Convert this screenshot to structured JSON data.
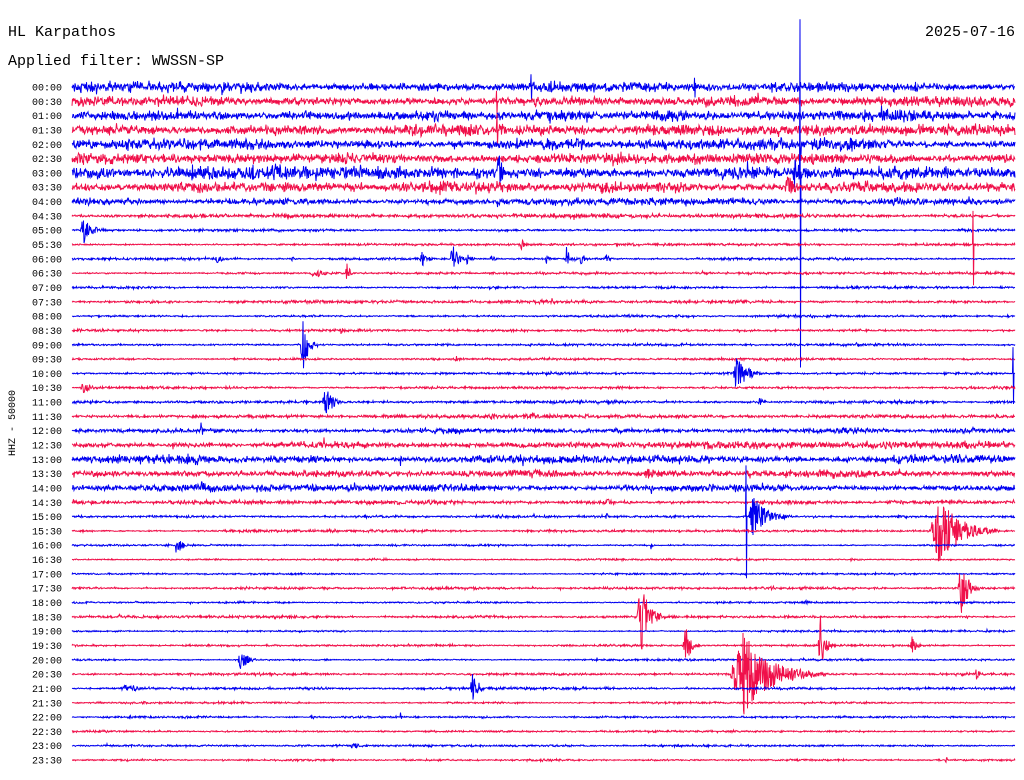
{
  "chart_data": {
    "type": "line",
    "title": "HL Karpathos",
    "date": "2025-07-16",
    "filter": "Applied filter: WWSSN-SP",
    "ylabel": "HHZ - 50000",
    "trace_colors": [
      "#0000f0",
      "#f0104a"
    ],
    "rows": [
      {
        "label": "00:00",
        "noise": 0.42,
        "events": [
          {
            "t": 14.6,
            "amp": 0.8,
            "dur": 0.05
          },
          {
            "t": 19.8,
            "amp": 0.7,
            "dur": 0.05
          }
        ]
      },
      {
        "label": "00:30",
        "noise": 0.42,
        "events": [
          {
            "t": 13.5,
            "amp": 0.7,
            "dur": 0.05
          }
        ]
      },
      {
        "label": "01:00",
        "noise": 0.45,
        "events": []
      },
      {
        "label": "01:30",
        "noise": 0.49,
        "events": [
          {
            "t": 13.52,
            "amp": 0.8,
            "dur": 0.05
          }
        ]
      },
      {
        "label": "02:00",
        "noise": 0.49,
        "events": [
          {
            "t": 23.16,
            "amp": 1.0,
            "dur": 0.1
          }
        ]
      },
      {
        "label": "02:30",
        "noise": 0.42,
        "events": []
      },
      {
        "label": "03:00",
        "noise": 0.49,
        "events": [
          {
            "t": 6.3,
            "amp": 0.7,
            "dur": 0.6
          },
          {
            "t": 13.52,
            "amp": 2.3,
            "dur": 0.35
          },
          {
            "t": 22.9,
            "amp": 1.1,
            "dur": 0.6
          },
          {
            "t": 23.16,
            "amp": 11,
            "dur": 0.05
          }
        ]
      },
      {
        "label": "03:30",
        "noise": 0.42,
        "events": [
          {
            "t": 22.68,
            "amp": 1.1,
            "dur": 0.7
          }
        ]
      },
      {
        "label": "04:00",
        "noise": 0.28,
        "events": [
          {
            "t": 13.52,
            "amp": 0.9,
            "dur": 0.1
          }
        ]
      },
      {
        "label": "04:30",
        "noise": 0.17,
        "events": []
      },
      {
        "label": "05:00",
        "noise": 0.1,
        "events": [
          {
            "t": 0.25,
            "amp": 1.0,
            "dur": 0.9
          }
        ]
      },
      {
        "label": "05:30",
        "noise": 0.1,
        "events": [
          {
            "t": 14.25,
            "amp": 0.4,
            "dur": 0.4
          },
          {
            "t": 28.66,
            "amp": 2.4,
            "dur": 0.05
          }
        ]
      },
      {
        "label": "06:00",
        "noise": 0.1,
        "events": [
          {
            "t": 4.55,
            "amp": 0.35,
            "dur": 0.6
          },
          {
            "t": 6.94,
            "amp": 0.2,
            "dur": 0.4
          },
          {
            "t": 11.07,
            "amp": 0.6,
            "dur": 0.5
          },
          {
            "t": 12.03,
            "amp": 1.05,
            "dur": 0.6
          },
          {
            "t": 12.5,
            "amp": 0.5,
            "dur": 0.4
          },
          {
            "t": 13.3,
            "amp": 0.4,
            "dur": 0.3
          },
          {
            "t": 15.05,
            "amp": 0.4,
            "dur": 0.3
          },
          {
            "t": 15.68,
            "amp": 1.0,
            "dur": 0.4
          },
          {
            "t": 16.16,
            "amp": 0.7,
            "dur": 0.3
          },
          {
            "t": 16.96,
            "amp": 0.5,
            "dur": 0.3
          }
        ]
      },
      {
        "label": "06:30",
        "noise": 0.1,
        "events": [
          {
            "t": 7.57,
            "amp": 0.35,
            "dur": 1.2
          },
          {
            "t": 8.69,
            "amp": 1.05,
            "dur": 0.3
          }
        ]
      },
      {
        "label": "07:00",
        "noise": 0.1,
        "events": []
      },
      {
        "label": "07:30",
        "noise": 0.13,
        "events": [
          {
            "t": 2.48,
            "amp": 0.21,
            "dur": 0.3
          }
        ]
      },
      {
        "label": "08:00",
        "noise": 0.1,
        "events": []
      },
      {
        "label": "08:30",
        "noise": 0.1,
        "events": [
          {
            "t": 8.53,
            "amp": 0.5,
            "dur": 0.3
          }
        ]
      },
      {
        "label": "09:00",
        "noise": 0.1,
        "events": [
          {
            "t": 7.25,
            "amp": 2.1,
            "dur": 0.6
          }
        ]
      },
      {
        "label": "09:30",
        "noise": 0.1,
        "events": [
          {
            "t": 12.18,
            "amp": 0.28,
            "dur": 0.3
          }
        ]
      },
      {
        "label": "10:00",
        "noise": 0.1,
        "events": [
          {
            "t": 21.03,
            "amp": 1.75,
            "dur": 0.9
          },
          {
            "t": 29.94,
            "amp": 1.8,
            "dur": 0.05
          }
        ]
      },
      {
        "label": "10:30",
        "noise": 0.1,
        "events": [
          {
            "t": 0.25,
            "amp": 0.49,
            "dur": 0.8
          }
        ]
      },
      {
        "label": "11:00",
        "noise": 0.12,
        "events": [
          {
            "t": 7.95,
            "amp": 1.12,
            "dur": 0.8
          },
          {
            "t": 17.05,
            "amp": 0.28,
            "dur": 0.2
          },
          {
            "t": 21.82,
            "amp": 0.42,
            "dur": 0.4
          }
        ]
      },
      {
        "label": "11:30",
        "noise": 0.14,
        "events": [
          {
            "t": 13.3,
            "amp": 0.35,
            "dur": 0.4
          },
          {
            "t": 14.57,
            "amp": 0.28,
            "dur": 0.4
          }
        ]
      },
      {
        "label": "12:00",
        "noise": 0.21,
        "events": [
          {
            "t": 4.07,
            "amp": 0.5,
            "dur": 0.3
          }
        ]
      },
      {
        "label": "12:30",
        "noise": 0.28,
        "events": []
      },
      {
        "label": "13:00",
        "noise": 0.35,
        "events": [
          {
            "t": 10.43,
            "amp": 0.7,
            "dur": 0.1
          }
        ]
      },
      {
        "label": "13:30",
        "noise": 0.28,
        "events": [
          {
            "t": 18.23,
            "amp": 0.56,
            "dur": 0.6
          }
        ]
      },
      {
        "label": "14:00",
        "noise": 0.28,
        "events": [
          {
            "t": 4.07,
            "amp": 0.49,
            "dur": 0.5
          },
          {
            "t": 18.39,
            "amp": 0.42,
            "dur": 0.4
          }
        ]
      },
      {
        "label": "14:30",
        "noise": 0.17,
        "events": [
          {
            "t": 17.0,
            "amp": 0.3,
            "dur": 0.3
          }
        ]
      },
      {
        "label": "15:00",
        "noise": 0.1,
        "events": [
          {
            "t": 16.96,
            "amp": 0.35,
            "dur": 0.2
          },
          {
            "t": 21.45,
            "amp": 3.6,
            "dur": 0.05
          },
          {
            "t": 21.51,
            "amp": 1.6,
            "dur": 1.4
          }
        ]
      },
      {
        "label": "15:30",
        "noise": 0.1,
        "events": [
          {
            "t": 27.29,
            "amp": 2.8,
            "dur": 2.2
          }
        ]
      },
      {
        "label": "16:00",
        "noise": 0.08,
        "events": [
          {
            "t": 3.28,
            "amp": 1.05,
            "dur": 0.5
          },
          {
            "t": 18.39,
            "amp": 0.56,
            "dur": 0.15
          }
        ]
      },
      {
        "label": "16:30",
        "noise": 0.08,
        "events": [
          {
            "t": 24.75,
            "amp": 0.21,
            "dur": 0.3
          }
        ]
      },
      {
        "label": "17:00",
        "noise": 0.08,
        "events": []
      },
      {
        "label": "17:30",
        "noise": 0.1,
        "events": [
          {
            "t": 22.21,
            "amp": 0.21,
            "dur": 0.3
          },
          {
            "t": 23.16,
            "amp": 0.21,
            "dur": 0.3
          },
          {
            "t": 28.19,
            "amp": 2.4,
            "dur": 0.7
          }
        ]
      },
      {
        "label": "18:00",
        "noise": 0.08,
        "events": [
          {
            "t": 2.0,
            "amp": 0.28,
            "dur": 0.2
          },
          {
            "t": 23.32,
            "amp": 0.28,
            "dur": 0.3
          }
        ]
      },
      {
        "label": "18:30",
        "noise": 0.1,
        "events": [
          {
            "t": 1.46,
            "amp": 0.28,
            "dur": 0.2
          },
          {
            "t": 17.97,
            "amp": 3.5,
            "dur": 0.8
          },
          {
            "t": 28.41,
            "amp": 0.21,
            "dur": 0.2
          }
        ]
      },
      {
        "label": "19:00",
        "noise": 0.08,
        "events": [
          {
            "t": 29.04,
            "amp": 0.21,
            "dur": 0.2
          }
        ]
      },
      {
        "label": "19:30",
        "noise": 0.1,
        "events": [
          {
            "t": 19.44,
            "amp": 1.4,
            "dur": 0.6
          },
          {
            "t": 23.73,
            "amp": 2.4,
            "dur": 0.5
          },
          {
            "t": 26.66,
            "amp": 0.7,
            "dur": 0.5
          }
        ]
      },
      {
        "label": "20:00",
        "noise": 0.08,
        "events": [
          {
            "t": 5.28,
            "amp": 1.26,
            "dur": 0.6
          }
        ]
      },
      {
        "label": "20:30",
        "noise": 0.1,
        "events": [
          {
            "t": 20.93,
            "amp": 3.1,
            "dur": 3.0
          },
          {
            "t": 28.73,
            "amp": 0.42,
            "dur": 0.4
          }
        ]
      },
      {
        "label": "21:00",
        "noise": 0.1,
        "events": [
          {
            "t": 1.53,
            "amp": 0.28,
            "dur": 1.5
          },
          {
            "t": 12.66,
            "amp": 1.26,
            "dur": 0.6
          }
        ]
      },
      {
        "label": "21:30",
        "noise": 0.08,
        "events": []
      },
      {
        "label": "22:00",
        "noise": 0.08,
        "events": [
          {
            "t": 7.57,
            "amp": 0.21,
            "dur": 0.4
          },
          {
            "t": 10.43,
            "amp": 0.42,
            "dur": 0.1
          }
        ]
      },
      {
        "label": "22:30",
        "noise": 0.08,
        "events": []
      },
      {
        "label": "23:00",
        "noise": 0.08,
        "events": [
          {
            "t": 8.84,
            "amp": 0.35,
            "dur": 0.6
          }
        ]
      },
      {
        "label": "23:30",
        "noise": 0.08,
        "events": [
          {
            "t": 27.77,
            "amp": 0.21,
            "dur": 0.2
          }
        ]
      }
    ]
  }
}
